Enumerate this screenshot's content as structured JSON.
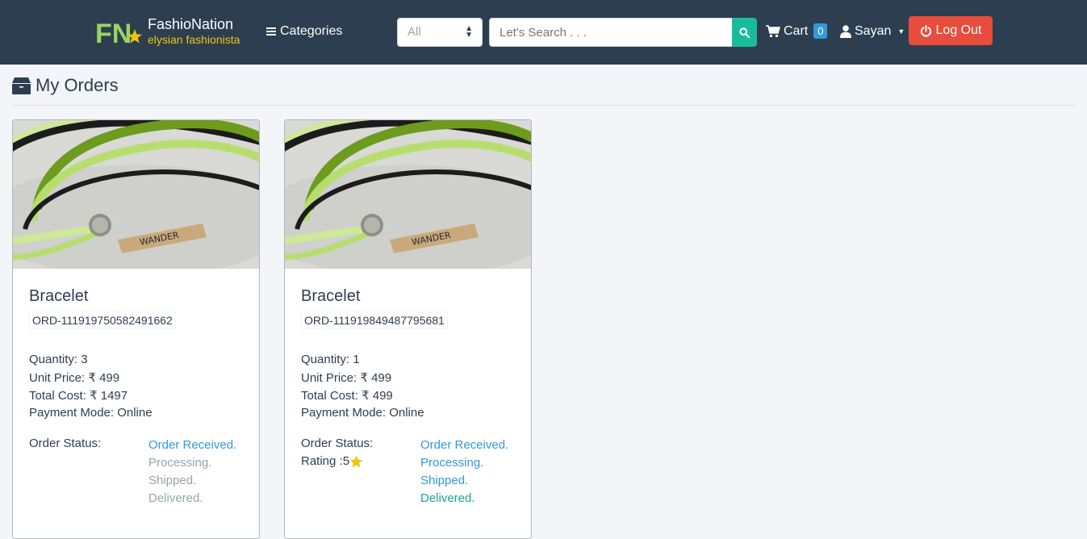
{
  "brand": {
    "logo": "FN",
    "name": "FashioNation",
    "tagline": "elysian fashionista"
  },
  "nav": {
    "categories": "Categories",
    "search_scope": "All",
    "search_placeholder": "Let's Search . . .",
    "cart_label": "Cart",
    "cart_count": "0",
    "user_name": "Sayan",
    "logout": "Log Out"
  },
  "page": {
    "title": "My Orders"
  },
  "colors": {
    "navbar": "#2c3e50",
    "accent": "#18bc9c",
    "danger": "#e74c3c",
    "info": "#3498db",
    "brand_yellow": "#f1c40f",
    "logo_green": "#9bd45f"
  },
  "orders": [
    {
      "title": "Bracelet",
      "order_id": "ORD-111919750582491662",
      "quantity": "Quantity: 3",
      "unit_price": "Unit Price: ₹ 499",
      "total_cost": "Total Cost: ₹ 1497",
      "payment_mode": "Payment Mode: Online",
      "status_label": "Order Status:",
      "steps": [
        {
          "label": "Order Received.",
          "done": true
        },
        {
          "label": "Processing.",
          "done": false
        },
        {
          "label": "Shipped.",
          "done": false
        },
        {
          "label": "Delivered.",
          "done": false
        }
      ]
    },
    {
      "title": "Bracelet",
      "order_id": "ORD-111919849487795681",
      "quantity": "Quantity: 1",
      "unit_price": "Unit Price: ₹ 499",
      "total_cost": "Total Cost: ₹ 499",
      "payment_mode": "Payment Mode: Online",
      "status_label": "Order Status:",
      "rating_label": "Rating : ",
      "rating_value": "5",
      "steps": [
        {
          "label": "Order Received.",
          "done": true
        },
        {
          "label": "Processing.",
          "done": true
        },
        {
          "label": "Shipped.",
          "done": true
        },
        {
          "label": "Delivered.",
          "done": true
        }
      ]
    }
  ]
}
